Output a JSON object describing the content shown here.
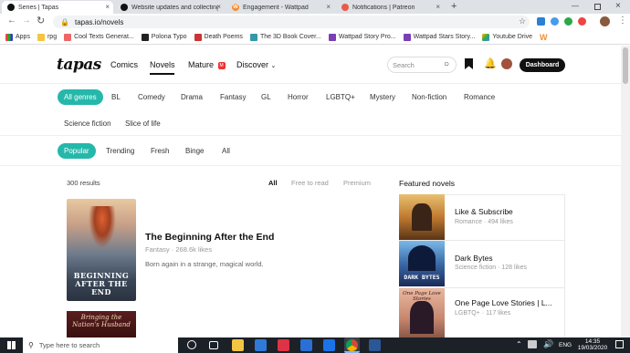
{
  "browser": {
    "tabs": [
      {
        "title": "Series | Tapas",
        "active": true
      },
      {
        "title": "Website updates and collecting t",
        "active": false
      },
      {
        "title": "Engagement - Wattpad",
        "active": false
      },
      {
        "title": "Notifications | Patreon",
        "active": false
      }
    ],
    "url": "tapas.io/novels",
    "bookmarks": [
      "Apps",
      "rpg",
      "Cool Texts Generat...",
      "Polona Typo",
      "Death Poems",
      "The 3D Book Cover...",
      "Wattpad Story Pro...",
      "Wattpad Stars Story...",
      "Youtube Drive"
    ]
  },
  "site": {
    "logo": "tapas",
    "nav": [
      "Comics",
      "Novels",
      "Mature",
      "Discover"
    ],
    "mature_badge": "M",
    "search_placeholder": "Search",
    "dashboard_label": "Dashboard"
  },
  "genres": [
    "All genres",
    "BL",
    "Comedy",
    "Drama",
    "Fantasy",
    "GL",
    "Horror",
    "LGBTQ+",
    "Mystery",
    "Non-fiction",
    "Romance",
    "Science fiction",
    "Slice of life"
  ],
  "sorts": [
    "Popular",
    "Trending",
    "Fresh",
    "Binge",
    "All"
  ],
  "results": {
    "count": "300 results",
    "filters": [
      "All",
      "Free to read",
      "Premium"
    ],
    "items": [
      {
        "title": "The Beginning After the End",
        "genre": "Fantasy",
        "likes": "268.6k likes",
        "description": "Born again in a strange, magical world.",
        "cover_text": "BEGINNING AFTER THE END"
      },
      {
        "cover_text": "Bringing the Nation's Husband"
      }
    ]
  },
  "featured": {
    "heading": "Featured novels",
    "items": [
      {
        "title": "Like & Subscribe",
        "genre": "Romance",
        "likes": "494 likes"
      },
      {
        "title": "Dark Bytes",
        "genre": "Science fiction",
        "likes": "128 likes",
        "cover_text": "DARK BYTES"
      },
      {
        "title": "One Page Love Stories | L...",
        "genre": "LGBTQ+",
        "likes": "117 likes",
        "cover_text": "One Page Love Stories"
      }
    ]
  },
  "taskbar": {
    "search_placeholder": "Type here to search",
    "lang": "ENG",
    "time": "14:35",
    "date": "19/03/2020"
  },
  "colors": {
    "accent": "#25b8aa",
    "tab_bg": "#dee1e6",
    "taskbar": "#1c2128"
  }
}
